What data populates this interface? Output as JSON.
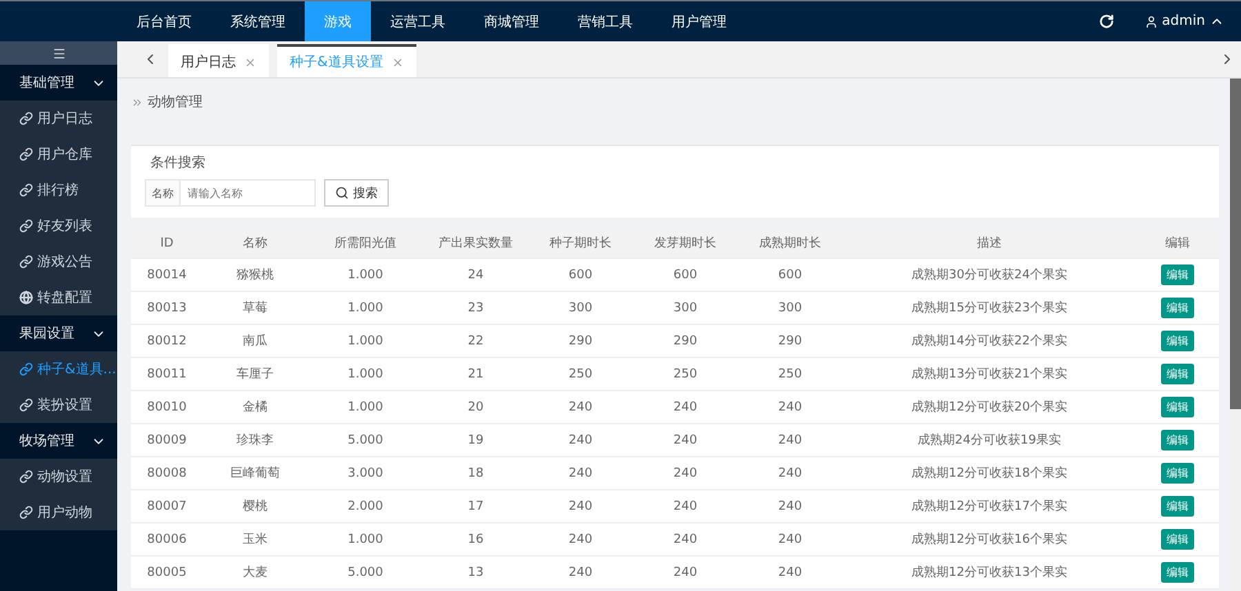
{
  "top_nav": {
    "items": [
      {
        "label": "后台首页",
        "selected": false
      },
      {
        "label": "系统管理",
        "selected": false
      },
      {
        "label": "游戏",
        "selected": true
      },
      {
        "label": "运营工具",
        "selected": false
      },
      {
        "label": "商城管理",
        "selected": false
      },
      {
        "label": "营销工具",
        "selected": false
      },
      {
        "label": "用户管理",
        "selected": false
      }
    ],
    "user": "admin"
  },
  "sidebar": {
    "groups": [
      {
        "label": "基础管理",
        "expanded": true,
        "items": [
          {
            "label": "用户日志",
            "kind": "link",
            "selected": false
          },
          {
            "label": "用户仓库",
            "kind": "link",
            "selected": false
          },
          {
            "label": "排行榜",
            "kind": "link",
            "selected": false
          },
          {
            "label": "好友列表",
            "kind": "link",
            "selected": false
          },
          {
            "label": "游戏公告",
            "kind": "link",
            "selected": false
          },
          {
            "label": "转盘配置",
            "kind": "globe",
            "selected": false
          }
        ]
      },
      {
        "label": "果园设置",
        "expanded": true,
        "items": [
          {
            "label": "种子&道具...",
            "kind": "link",
            "selected": true
          },
          {
            "label": "装扮设置",
            "kind": "link",
            "selected": false
          }
        ]
      },
      {
        "label": "牧场管理",
        "expanded": true,
        "items": [
          {
            "label": "动物设置",
            "kind": "link",
            "selected": false
          },
          {
            "label": "用户动物",
            "kind": "link",
            "selected": false
          }
        ]
      }
    ]
  },
  "tabs": [
    {
      "label": "用户日志",
      "selected": false
    },
    {
      "label": "种子&道具设置",
      "selected": true
    }
  ],
  "breadcrumb": "动物管理",
  "search": {
    "legend": "条件搜索",
    "field_label": "名称",
    "placeholder": "请输入名称",
    "button": "搜索"
  },
  "table": {
    "columns": [
      "ID",
      "名称",
      "所需阳光值",
      "产出果实数量",
      "种子期时长",
      "发芽期时长",
      "成熟期时长",
      "描述",
      "编辑"
    ],
    "rows": [
      {
        "cells": [
          "80014",
          "猕猴桃",
          "1.000",
          "24",
          "600",
          "600",
          "600",
          "成熟期30分可收获24个果实"
        ],
        "action": "编辑"
      },
      {
        "cells": [
          "80013",
          "草莓",
          "1.000",
          "23",
          "300",
          "300",
          "300",
          "成熟期15分可收获23个果实"
        ],
        "action": "编辑"
      },
      {
        "cells": [
          "80012",
          "南瓜",
          "1.000",
          "22",
          "290",
          "290",
          "290",
          "成熟期14分可收获22个果实"
        ],
        "action": "编辑"
      },
      {
        "cells": [
          "80011",
          "车厘子",
          "1.000",
          "21",
          "250",
          "250",
          "250",
          "成熟期13分可收获21个果实"
        ],
        "action": "编辑"
      },
      {
        "cells": [
          "80010",
          "金橘",
          "1.000",
          "20",
          "240",
          "240",
          "240",
          "成熟期12分可收获20个果实"
        ],
        "action": "编辑"
      },
      {
        "cells": [
          "80009",
          "珍珠李",
          "5.000",
          "19",
          "240",
          "240",
          "240",
          "成熟期24分可收获19果实"
        ],
        "action": "编辑"
      },
      {
        "cells": [
          "80008",
          "巨峰葡萄",
          "3.000",
          "18",
          "240",
          "240",
          "240",
          "成熟期12分可收获18个果实"
        ],
        "action": "编辑"
      },
      {
        "cells": [
          "80007",
          "樱桃",
          "2.000",
          "17",
          "240",
          "240",
          "240",
          "成熟期12分可收获17个果实"
        ],
        "action": "编辑"
      },
      {
        "cells": [
          "80006",
          "玉米",
          "1.000",
          "16",
          "240",
          "240",
          "240",
          "成熟期12分可收获16个果实"
        ],
        "action": "编辑"
      },
      {
        "cells": [
          "80005",
          "大麦",
          "5.000",
          "13",
          "240",
          "240",
          "240",
          "成熟期12分可收获13个果实"
        ],
        "action": "编辑"
      }
    ]
  }
}
